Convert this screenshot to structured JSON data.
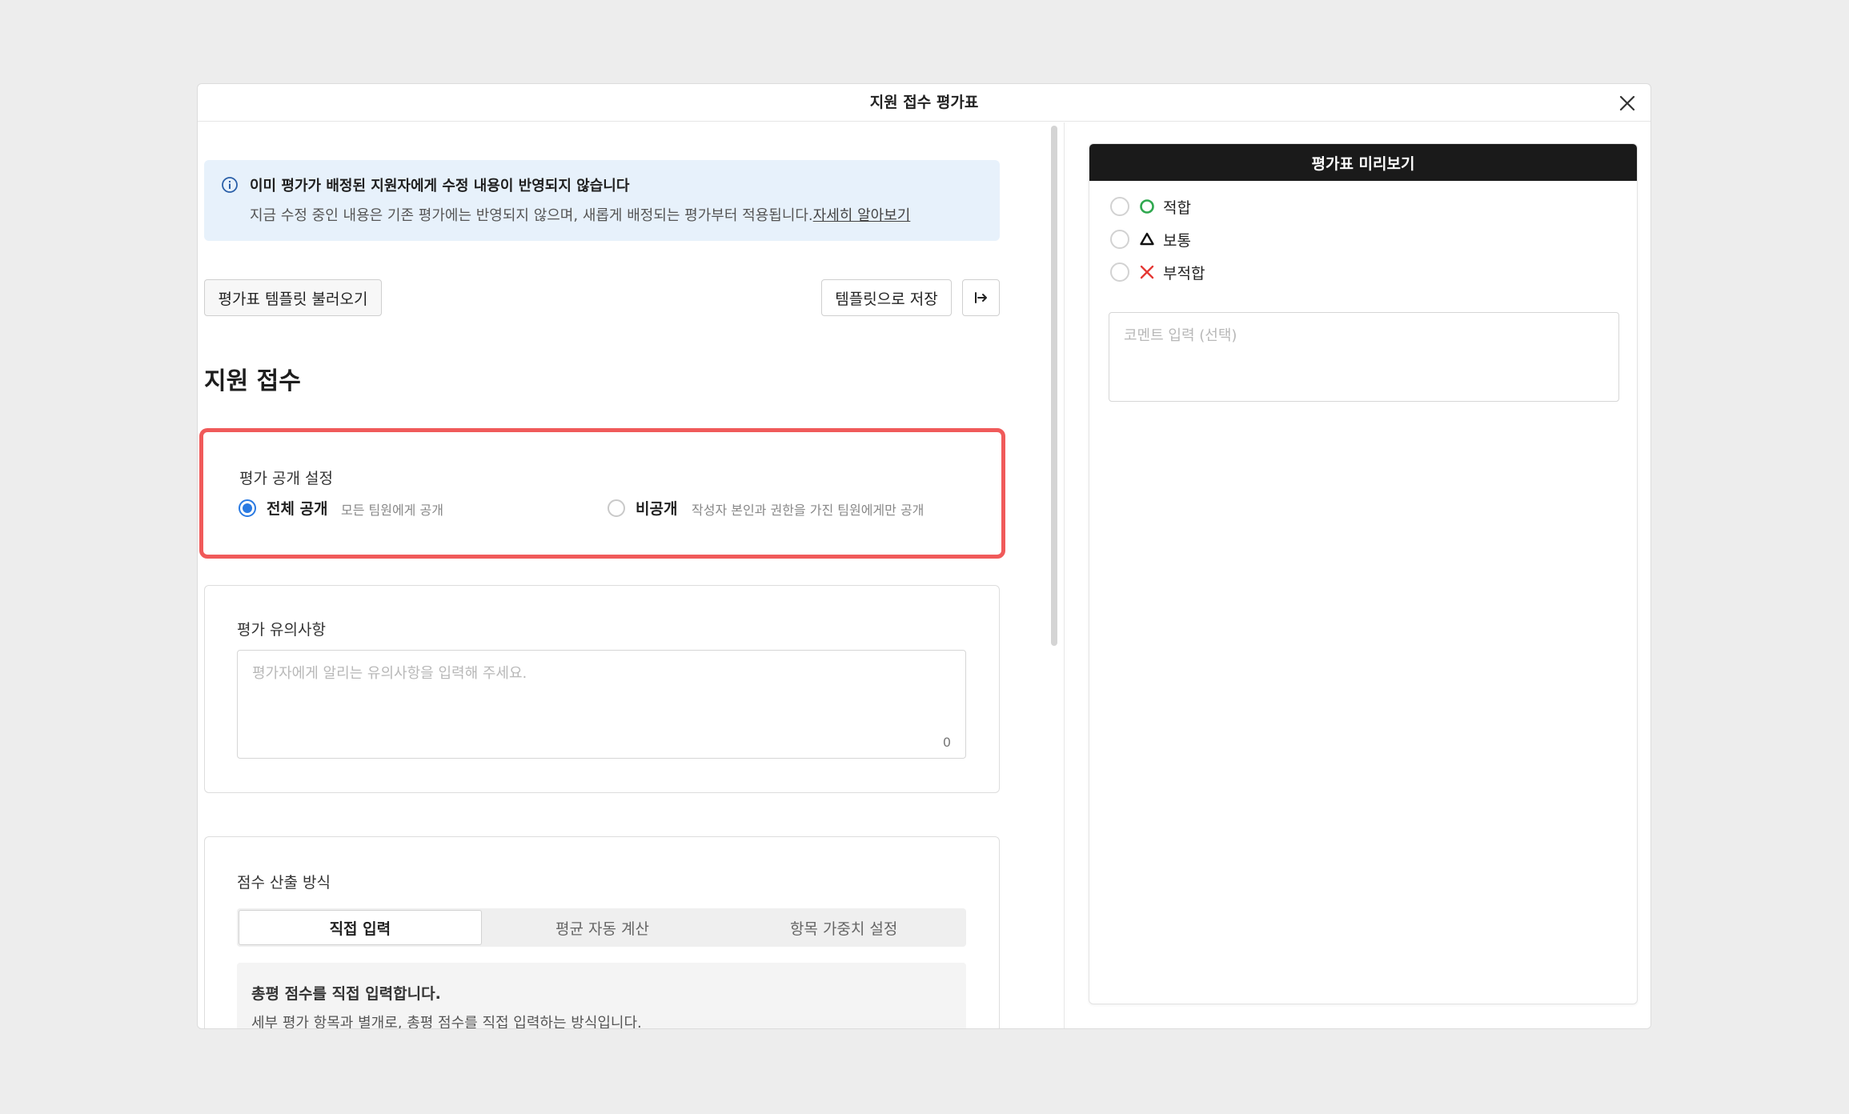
{
  "modal": {
    "title": "지원 접수 평가표"
  },
  "info": {
    "title": "이미 평가가 배정된 지원자에게 수정 내용이 반영되지 않습니다",
    "description": "지금 수정 중인 내용은 기존 평가에는 반영되지 않으며, 새롭게 배정되는 평가부터 적용됩니다.",
    "link": "자세히 알아보기"
  },
  "toolbar": {
    "load_template": "평가표 템플릿 불러오기",
    "save_template": "템플릿으로 저장",
    "export_icon": "arrow-right-to-line-icon"
  },
  "section": {
    "title": "지원 접수"
  },
  "visibility": {
    "label": "평가 공개 설정",
    "options": [
      {
        "label": "전체 공개",
        "desc": "모든 팀원에게 공개",
        "checked": true
      },
      {
        "label": "비공개",
        "desc": "작성자 본인과 권한을 가진 팀원에게만 공개",
        "checked": false
      }
    ]
  },
  "notice": {
    "label": "평가 유의사항",
    "placeholder": "평가자에게 알리는 유의사항을 입력해 주세요.",
    "count": "0"
  },
  "scoring": {
    "label": "점수 산출 방식",
    "tabs": [
      "직접 입력",
      "평균 자동 계산",
      "항목 가중치 설정"
    ],
    "active_tab": 0,
    "method_title": "총평 점수를 직접 입력합니다.",
    "method_desc": "세부 평가 항목과 별개로, 총평 점수를 직접 입력하는 방식입니다."
  },
  "preview": {
    "title": "평가표 미리보기",
    "options": [
      {
        "label": "적합",
        "icon": "circle-icon",
        "color": "#2fa84f"
      },
      {
        "label": "보통",
        "icon": "triangle-icon",
        "color": "#111111"
      },
      {
        "label": "부적합",
        "icon": "x-mark-icon",
        "color": "#e53935"
      }
    ],
    "comment_placeholder": "코멘트 입력 (선택)"
  }
}
